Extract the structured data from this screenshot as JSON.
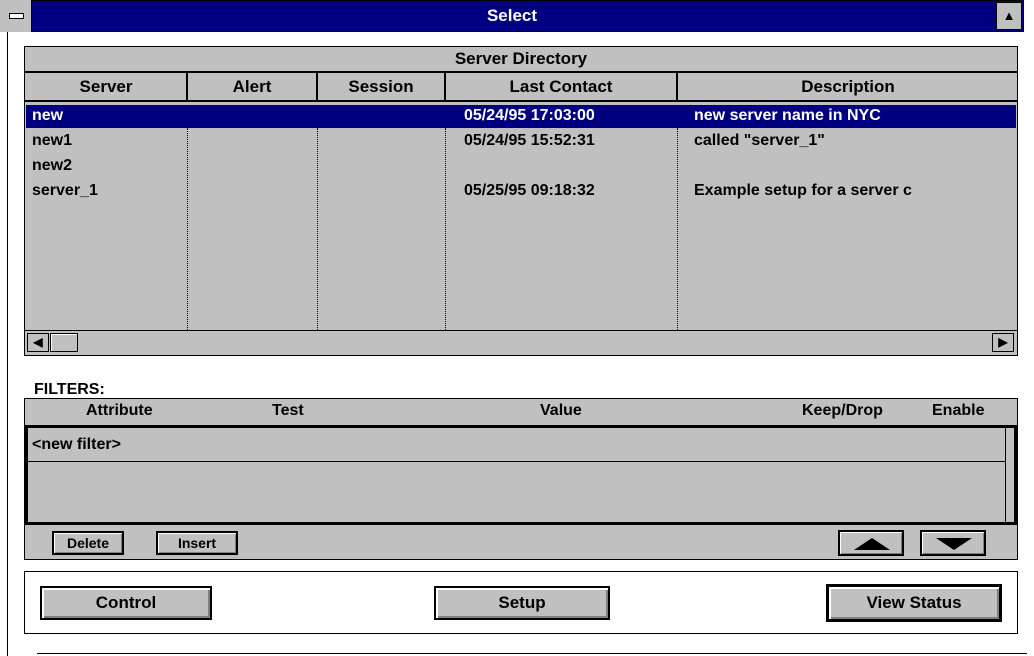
{
  "window": {
    "title": "Select"
  },
  "server_directory": {
    "title": "Server Directory",
    "columns": [
      "Server",
      "Alert",
      "Session",
      "Last Contact",
      "Description"
    ],
    "rows": [
      {
        "server": "new",
        "alert": "",
        "session": "",
        "last_contact": "05/24/95 17:03:00",
        "description": "new server name in NYC"
      },
      {
        "server": "new1",
        "alert": "",
        "session": "",
        "last_contact": "05/24/95 15:52:31",
        "description": "called \"server_1\""
      },
      {
        "server": "new2",
        "alert": "",
        "session": "",
        "last_contact": "",
        "description": ""
      },
      {
        "server": "server_1",
        "alert": "",
        "session": "",
        "last_contact": "05/25/95 09:18:32",
        "description": "Example setup for a server c"
      }
    ],
    "selected_row": "new"
  },
  "filters": {
    "label": "FILTERS:",
    "columns": [
      "Attribute",
      "Test",
      "Value",
      "Keep/Drop",
      "Enable"
    ],
    "new_filter_text": "<new filter>",
    "delete_label": "Delete",
    "insert_label": "Insert"
  },
  "buttons": {
    "control": "Control",
    "setup": "Setup",
    "view_status": "View Status"
  },
  "icons": {
    "system_menu": "system-menu-icon",
    "maximize": "maximize-icon",
    "scroll_left": "left-arrow-icon",
    "scroll_right": "right-arrow-icon",
    "move_up": "up-triangle-icon",
    "move_down": "down-triangle-icon"
  },
  "colors": {
    "titlebar": "#000080",
    "selection": "#000080",
    "panel": "#c0c0c0"
  }
}
